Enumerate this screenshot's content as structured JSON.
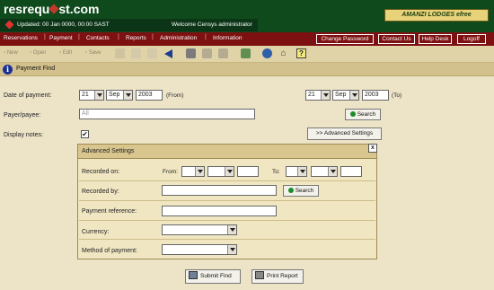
{
  "header": {
    "logo_pre": "resrequ",
    "logo_post": "st.com",
    "updated_text": "Updated: 00 Jan 0000, 00:00 SAST",
    "welcome_text": "Welcome Censys administrator",
    "brand_badge": "AMANZI LODGES efree"
  },
  "nav": {
    "items": [
      "Reservations",
      "Payment",
      "Contacts",
      "Reports",
      "Administration",
      "Information"
    ],
    "right_buttons": [
      "Change Password",
      "Contact Us",
      "Help Desk",
      "Logoff"
    ]
  },
  "toolbar": {
    "new_label": "New",
    "open_label": "Open",
    "edit_label": "Edit",
    "save_label": "Save"
  },
  "page": {
    "title": "Payment Find"
  },
  "form": {
    "date_label": "Date of payment:",
    "from_day": "21",
    "from_month": "Sep",
    "from_year": "2003",
    "from_suffix": "(From)",
    "to_day": "21",
    "to_month": "Sep",
    "to_year": "2003",
    "to_suffix": "(To)",
    "payer_label": "Payer/payee:",
    "payer_value": "All",
    "search_label": "Search",
    "display_notes_label": "Display notes:",
    "display_notes_checked": "✔",
    "advanced_button_label": ">>   Advanced Settings"
  },
  "advanced": {
    "title": "Advanced Settings",
    "close_label": "x",
    "recorded_on_label": "Recorded on:",
    "from_label": "From:",
    "to_label": "To:",
    "recorded_by_label": "Recorded by:",
    "search_label": "Search",
    "payment_reference_label": "Payment reference:",
    "currency_label": "Currency:",
    "method_label": "Method of payment:"
  },
  "footer": {
    "submit_label": "Submit Find",
    "print_label": "Print Report"
  },
  "colors": {
    "header_green": "#0f4a1c",
    "nav_red": "#7d1010",
    "toolbar_tan": "#e0d3a8",
    "body_bg": "#ede4c8"
  }
}
